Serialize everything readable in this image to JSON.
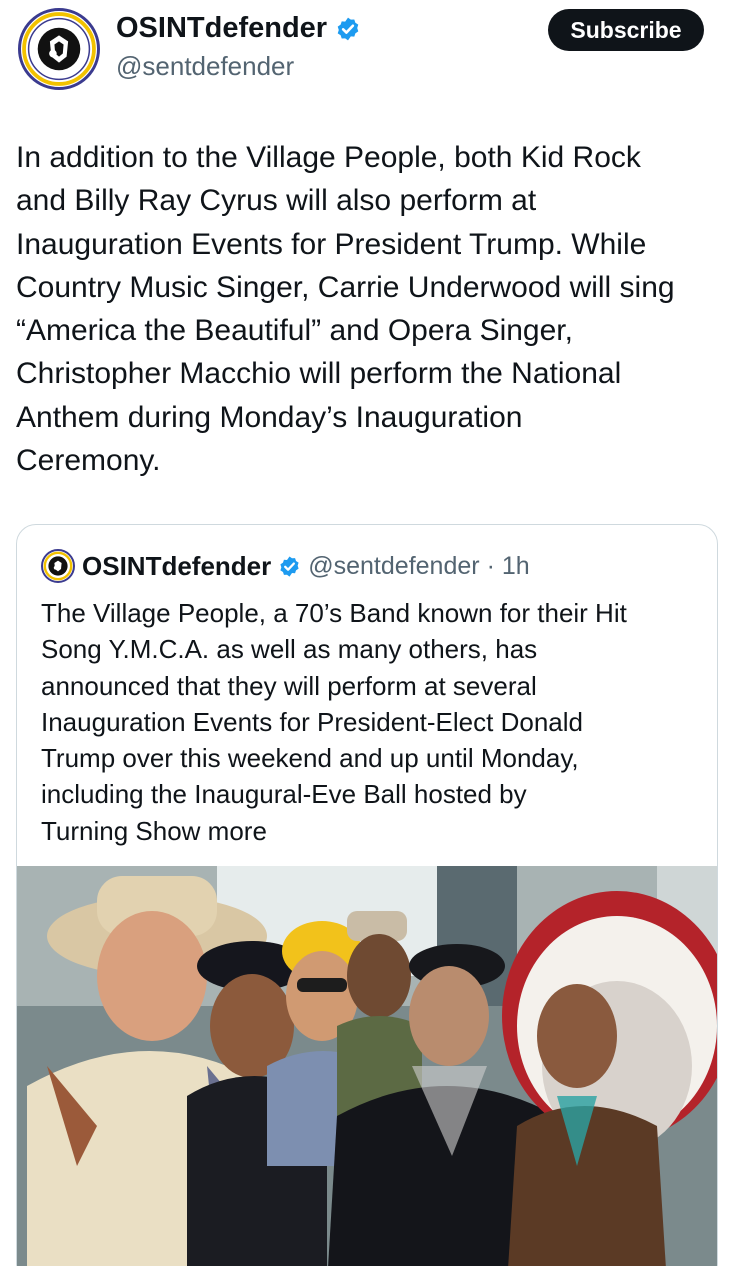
{
  "tweet": {
    "author_name": "OSINTdefender",
    "handle": "@sentdefender",
    "subscribe_label": "Subscribe",
    "text": "In addition to the Village People, both Kid Rock\nand Billy Ray Cyrus will also perform at\nInauguration Events for President Trump. While\nCountry Music Singer, Carrie Underwood will sing\n“America the Beautiful” and Opera Singer,\nChristopher Macchio will perform the National\nAnthem during Monday’s Inauguration\nCeremony."
  },
  "quote": {
    "author_name": "OSINTdefender",
    "handle": "@sentdefender",
    "separator": "·",
    "time": "1h",
    "text": "The Village People, a 70’s Band known for their Hit\nSong Y.M.C.A. as well as many others, has\nannounced that they will perform at several\nInauguration Events for President-Elect Donald\nTrump over this weekend and up until Monday,\nincluding the Inaugural-Eve Ball hosted by\nTurning ",
    "show_more": "Show more"
  },
  "icons": {
    "verified": "verified-badge-icon",
    "avatar": "osintdefender-logo"
  },
  "colors": {
    "verified_blue": "#1d9bf0",
    "text": "#0f1419",
    "secondary": "#536471",
    "button_bg": "#0f1419",
    "border": "#cfd9de"
  }
}
